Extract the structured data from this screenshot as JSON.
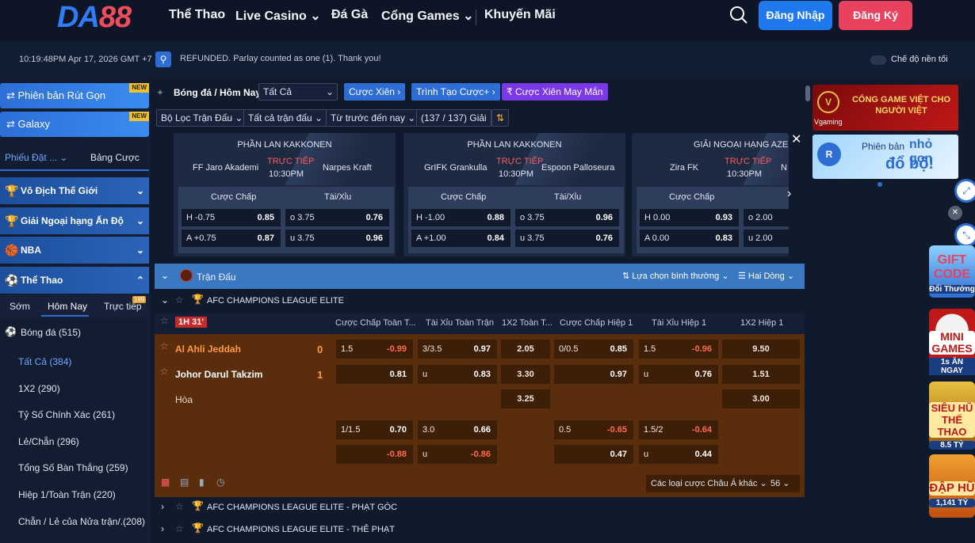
{
  "nav": {
    "logo_da": "DA",
    "logo_88": "88",
    "links": [
      "Thể Thao",
      "Live Casino",
      "Đá Gà",
      "Cổng Games",
      "Khuyến Mãi"
    ],
    "login": "Đăng Nhập",
    "register": "Đăng Ký"
  },
  "info": {
    "datetime": "10:19:48PM Apr 17, 2026 GMT +7",
    "message": "REFUNDED. Parlay counted as one (1). Thank you!",
    "dark_mode": "Chế độ nền tối"
  },
  "sidebar": {
    "promo1": "Phiên bản Rút Gọn",
    "promo2": "Galaxy",
    "new": "NEW",
    "tab_bets": "Phiếu Đặt ...",
    "tab_table": "Bảng Cược",
    "sections": [
      "Vô Địch Thế Giới",
      "Giải Ngoại hạng Ấn Độ",
      "NBA",
      "Thể Thao"
    ],
    "time_tabs": [
      "Sớm",
      "Hôm Nay",
      "Trực tiếp"
    ],
    "live_count": "199",
    "sport": "Bóng đá",
    "sport_count": "(515)",
    "items": [
      {
        "label": "Tất Cả",
        "count": "(384)"
      },
      {
        "label": "1X2",
        "count": "(290)"
      },
      {
        "label": "Tỷ Số Chính Xác",
        "count": "(261)"
      },
      {
        "label": "Lẻ/Chẵn",
        "count": "(296)"
      },
      {
        "label": "Tổng Số Bàn Thắng",
        "count": "(259)"
      },
      {
        "label": "Hiệp 1/Toàn Trận",
        "count": "(220)"
      },
      {
        "label": "Chẵn / Lẻ của Nửa trận/...",
        "count": "(208)"
      }
    ]
  },
  "toolbar": {
    "breadcrumb": "Bóng đá / Hôm Nay",
    "filter_all": "Tất Cả",
    "parlay": "Cược Xiên",
    "builder": "Trình Tạo Cược+",
    "lucky": "Cược Xiên May Mắn",
    "match_filter": "Bộ Lọc Trận Đấu",
    "all_matches": "Tất cả trận đấu",
    "from_today": "Từ trước đến nay",
    "leagues": "(137 / 137) Giải"
  },
  "cards": [
    {
      "league": "PHẦN LAN KAKKONEN",
      "home": "FF Jaro Akademi",
      "away": "Narpes Kraft",
      "live": "TRỰC TIẾP",
      "time": "10:30PM",
      "hcap": "Cược Chấp",
      "ou": "Tài/Xỉu",
      "r1": [
        "H -0.75",
        "0.85",
        "o 3.75",
        "0.76"
      ],
      "r2": [
        "A +0.75",
        "0.87",
        "u 3.75",
        "0.96"
      ]
    },
    {
      "league": "PHẦN LAN KAKKONEN",
      "home": "GrIFK Grankulla",
      "away": "Espoon Palloseura",
      "live": "TRỰC TIẾP",
      "time": "10:30PM",
      "hcap": "Cược Chấp",
      "ou": "Tài/Xỉu",
      "r1": [
        "H -1.00",
        "0.88",
        "o 3.75",
        "0.96"
      ],
      "r2": [
        "A +1.00",
        "0.84",
        "u 3.75",
        "0.76"
      ]
    },
    {
      "league": "GIẢI NGOẠI HẠNG AZE...",
      "home": "Zira FK",
      "away": "N",
      "live": "TRỰC TIẾP",
      "time": "10:30PM",
      "hcap": "Cược Chấp",
      "ou": "",
      "r1": [
        "H 0.00",
        "0.93",
        "o 2.00",
        ""
      ],
      "r2": [
        "A 0.00",
        "0.83",
        "u 2.00",
        ""
      ]
    }
  ],
  "matchbar": {
    "title": "Trận Đấu",
    "selection": "Lựa chọn bình thường",
    "lines": "Hai Dòng"
  },
  "league1": "AFC CHAMPIONS LEAGUE ELITE",
  "live_badge": "1H 31'",
  "cols": [
    "Cược Chấp Toàn T...",
    "Tài Xỉu Toàn Trận",
    "1X2 Toàn T...",
    "Cược Chấp Hiệp 1",
    "Tài Xỉu Hiệp 1",
    "1X2 Hiệp 1"
  ],
  "match": {
    "home": "Al Ahli Jeddah",
    "home_score": "0",
    "away": "Johor Darul Takzim",
    "away_score": "1",
    "draw": "Hòa"
  },
  "odds": {
    "r1": [
      "1.5",
      "-0.99",
      "3/3.5",
      "0.97",
      "2.05",
      "0/0.5",
      "0.85",
      "1.5",
      "-0.96",
      "9.50"
    ],
    "r2": [
      "0.81",
      "u",
      "0.83",
      "3.30",
      "0.97",
      "u",
      "0.76",
      "1.51"
    ],
    "r3": [
      "3.25",
      "3.00"
    ],
    "r4": [
      "1/1.5",
      "0.70",
      "3.0",
      "0.66",
      "0.5",
      "-0.65",
      "1.5/2",
      "-0.64"
    ],
    "r5": [
      "-0.88",
      "u",
      "-0.86",
      "0.47",
      "u",
      "0.44"
    ]
  },
  "footer": {
    "other": "Các loại cược Châu Á khác",
    "count": "56"
  },
  "leagues_more": [
    "AFC CHAMPIONS LEAGUE ELITE - PHẠT GÓC",
    "AFC CHAMPIONS LEAGUE ELITE - THẺ PHẠT"
  ],
  "banners": {
    "b1": "CỔNG GAME VIỆT CHO NGƯỜI VIỆT",
    "b1_brand": "Vgaming",
    "b2a": "Phiên bản",
    "b2b": "nhỏ gọn",
    "b2c": "đổ bộ!"
  },
  "right_badges": [
    {
      "t": "GIFT CODE",
      "s": "Đổi Thưởng"
    },
    {
      "t": "MINI GAMES",
      "s": "1s ĂN NGAY"
    },
    {
      "t": "SIÊU HŨ THỂ THAO",
      "s": "8.5 TỶ"
    },
    {
      "t": "ĐẬP HŨ",
      "s": "1,141 TỶ"
    }
  ],
  "colors": {
    "accent": "#2e6dd3",
    "match_bg": "#5a2d0d",
    "brand_red": "#e8425e"
  }
}
